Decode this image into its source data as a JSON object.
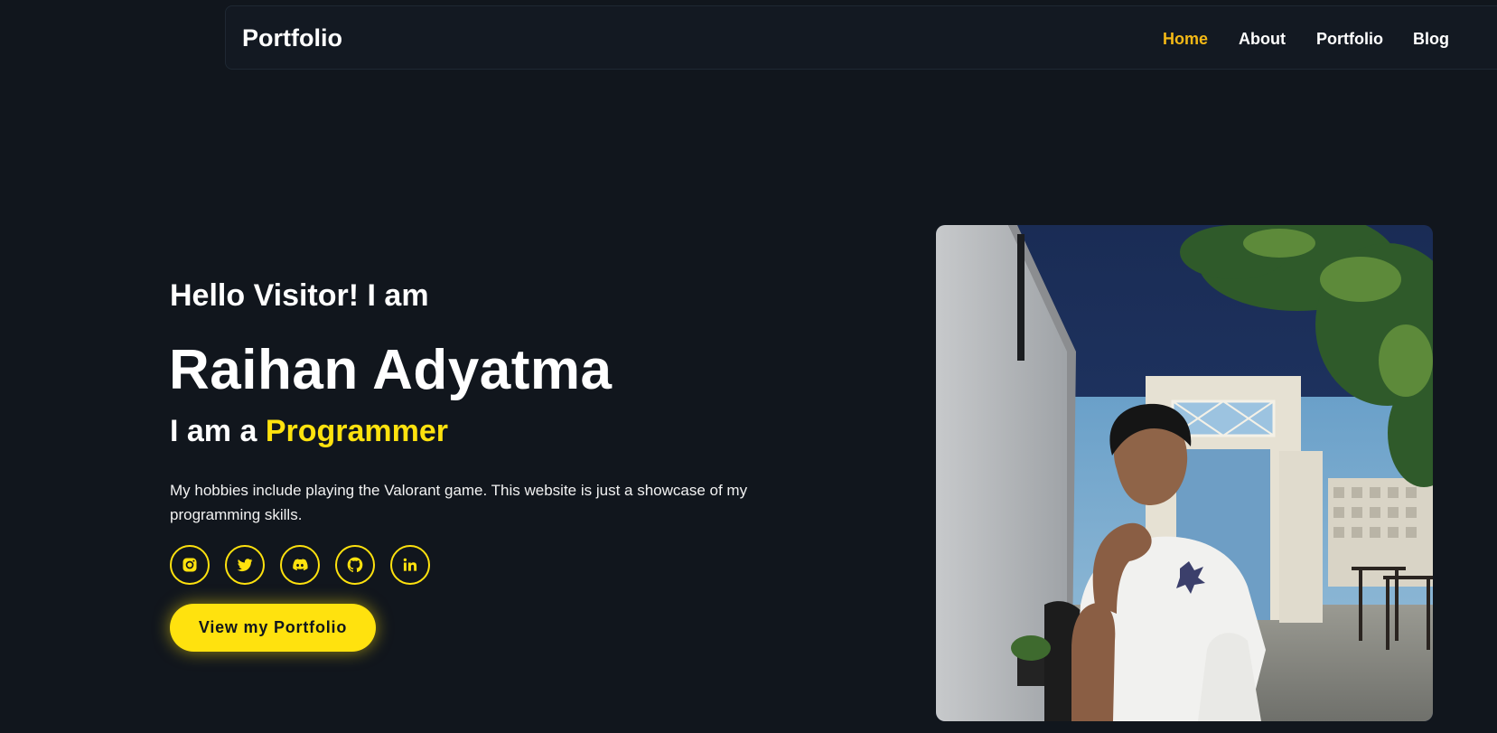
{
  "navbar": {
    "brand": "Portfolio",
    "links": [
      {
        "label": "Home",
        "active": true
      },
      {
        "label": "About",
        "active": false
      },
      {
        "label": "Portfolio",
        "active": false
      },
      {
        "label": "Blog",
        "active": false
      }
    ]
  },
  "hero": {
    "greeting": "Hello Visitor! I am",
    "name": "Raihan Adyatma",
    "role_prefix": "I am a",
    "role": "Programmer",
    "bio": "My hobbies include playing the Valorant game. This website is just a showcase of my programming skills.",
    "cta_label": "View my Portfolio"
  },
  "socials": [
    {
      "icon": "instagram-icon"
    },
    {
      "icon": "twitter-icon"
    },
    {
      "icon": "discord-icon"
    },
    {
      "icon": "github-icon"
    },
    {
      "icon": "linkedin-icon"
    }
  ],
  "colors": {
    "background": "#11161d",
    "accent": "#ffe20e",
    "nav_active": "#f4b916",
    "text": "#ffffff"
  }
}
